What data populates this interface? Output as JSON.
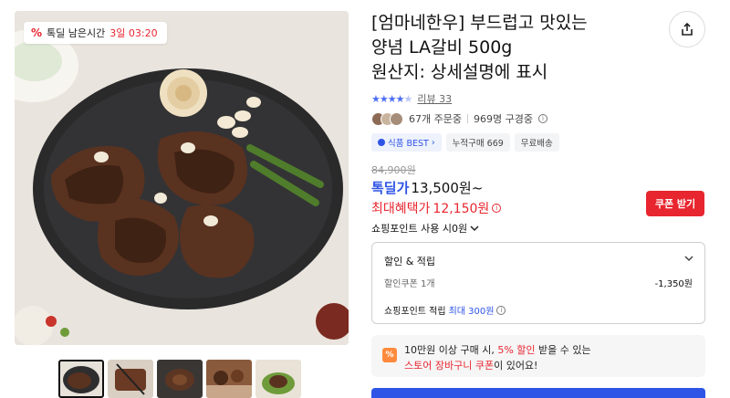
{
  "deal_badge": {
    "label": "톡딜 남은시간",
    "time": "3일 03:20",
    "icon": "percent-tag-icon"
  },
  "product": {
    "title_lines": [
      "[엄마네한우] 부드럽고 맛있는",
      "양념 LA갈비 500g",
      "원산지: 상세설명에 표시"
    ]
  },
  "rating": {
    "stars": 4.5,
    "review_label": "리뷰 33"
  },
  "orders": {
    "count_label": "67개 주문중",
    "viewers_label": "969명 구경중"
  },
  "chips": [
    {
      "label": "식품 BEST",
      "suffix": "›"
    },
    {
      "label": "누적구매 669"
    },
    {
      "label": "무료배송"
    }
  ],
  "price": {
    "original": "84,900원",
    "deal_label": "톡딜가",
    "deal_value": "13,500원~",
    "max_label": "최대혜택가",
    "max_value": "12,150원",
    "point_use": "쇼핑포인트 사용 시0원"
  },
  "coupon_button": "쿠폰 받기",
  "benefits": {
    "header": "할인 & 적립",
    "coupon_label": "할인쿠폰 1개",
    "coupon_amount": "-1,350원",
    "point_label": "쇼핑포인트 적립",
    "point_highlight": "최대 300원"
  },
  "promo": {
    "line1_a": "10만원 이상 구매 시, ",
    "line1_red": "5% 할인",
    "line1_b": " 받을 수 있는",
    "line2_red": "스토어 장바구니 쿠폰",
    "line2_b": "이 있어요!"
  },
  "colors": {
    "accent_blue": "#2f55e6",
    "accent_red": "#e8262f",
    "promo_orange": "#ff8a3d"
  }
}
